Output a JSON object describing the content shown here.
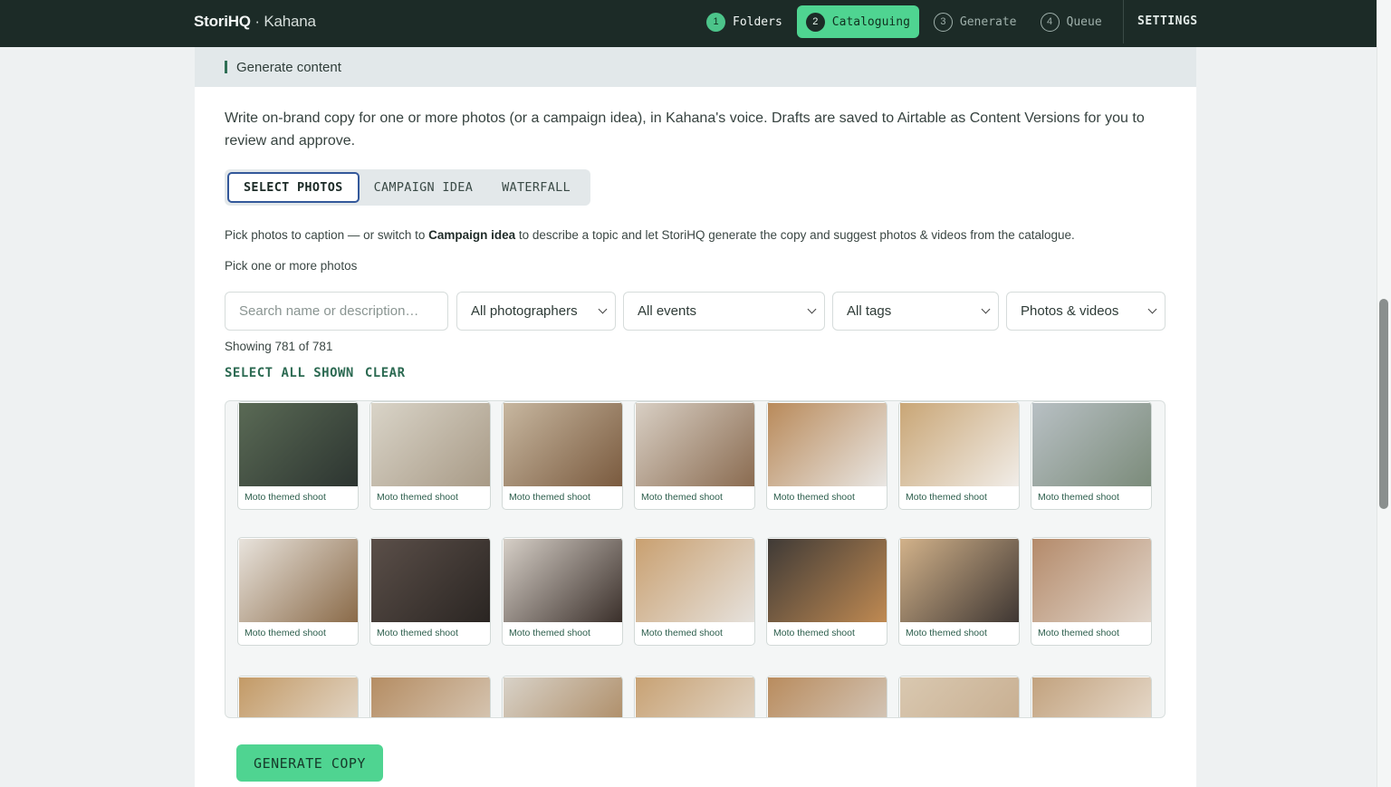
{
  "brand": {
    "name": "StoriHQ",
    "separator": " · ",
    "client": "Kahana"
  },
  "steps": [
    {
      "num": "1",
      "label": "Folders",
      "state": "done"
    },
    {
      "num": "2",
      "label": "Cataloguing",
      "state": "active"
    },
    {
      "num": "3",
      "label": "Generate",
      "state": "todo"
    },
    {
      "num": "4",
      "label": "Queue",
      "state": "todo"
    }
  ],
  "settings_label": "SETTINGS",
  "section": {
    "title": "Generate content"
  },
  "intro": "Write on-brand copy for one or more photos (or a campaign idea), in Kahana's voice. Drafts are saved to Airtable as Content Versions for you to review and approve.",
  "modes": {
    "select_photos": "SELECT PHOTOS",
    "campaign_idea": "CAMPAIGN IDEA",
    "waterfall": "WATERFALL"
  },
  "help": {
    "pre": "Pick photos to caption — or switch to ",
    "bold": "Campaign idea",
    "post": " to describe a topic and let StoriHQ generate the copy and suggest photos & videos from the catalogue."
  },
  "pick_label": "Pick one or more photos",
  "filters": {
    "search_placeholder": "Search name or description…",
    "photographers": "All photographers",
    "events": "All events",
    "tags": "All tags",
    "media": "Photos & videos"
  },
  "showing": "Showing 781 of 781",
  "actions": {
    "select_all": "SELECT ALL SHOWN",
    "clear": "CLEAR"
  },
  "tile_caption": "Moto themed shoot",
  "generate_label": "GENERATE COPY",
  "colors": {
    "topbar": "#1c2b27",
    "accent": "#4fd491",
    "link": "#2c6a52"
  }
}
